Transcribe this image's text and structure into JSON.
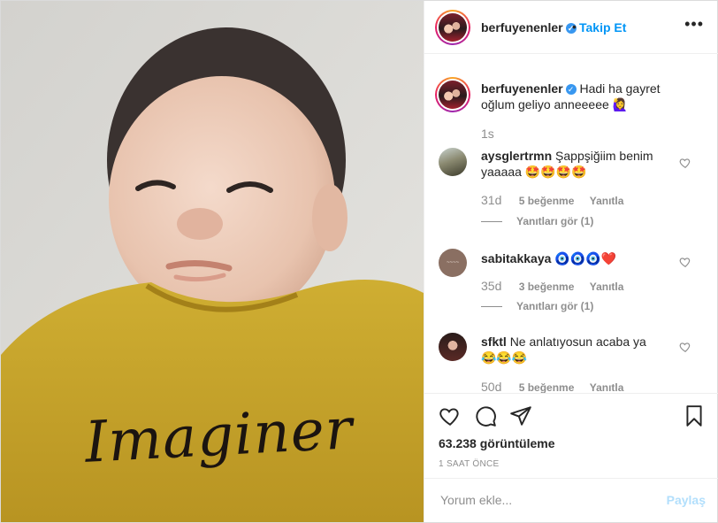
{
  "post": {
    "author": {
      "username": "berfuyenenler",
      "verified": true,
      "follow_label": "Takip Et"
    },
    "media": {
      "shirt_text": "Imaginer"
    },
    "caption": {
      "username": "berfuyenenler",
      "text": "Hadi ha gayret oğlum geliyo anneeeee",
      "emoji": "🙋‍♀️",
      "time": "1s"
    },
    "comments": [
      {
        "username": "aysglertrmn",
        "text": "Şappşiğiim benim yaaaaa",
        "emoji": "🤩🤩🤩🤩",
        "time": "31d",
        "likes": "5 beğenme",
        "reply_label": "Yanıtla",
        "view_replies": "Yanıtları gör (1)"
      },
      {
        "username": "sabitakkaya",
        "text": "",
        "emoji": "🧿🧿🧿❤️",
        "time": "35d",
        "likes": "3 beğenme",
        "reply_label": "Yanıtla",
        "view_replies": "Yanıtları gör (1)"
      },
      {
        "username": "sfktl",
        "text": "Ne anlatıyosun acaba ya",
        "emoji": "😂😂😂",
        "time": "50d",
        "likes": "5 beğenme",
        "reply_label": "Yanıtla"
      }
    ],
    "stats": {
      "views": "63.238 görüntüleme",
      "posted": "1 SAAT ÖNCE"
    },
    "add_comment": {
      "placeholder": "Yorum ekle...",
      "post_label": "Paylaş"
    },
    "icons": {
      "more": "more-options-icon",
      "like": "heart-icon",
      "comment": "comment-icon",
      "share": "share-icon",
      "save": "bookmark-icon",
      "verified": "verified-badge-icon"
    },
    "colors": {
      "link": "#0095f6",
      "verified": "#3897f0",
      "muted": "#8e8e8e",
      "shirt": "#c9a62a"
    }
  }
}
